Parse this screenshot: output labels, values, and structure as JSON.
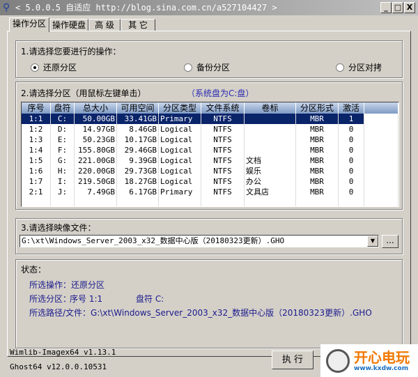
{
  "title": "< 5.0.0.5 自适应 http://blog.sina.com.cn/a527104427 >",
  "window_buttons": {
    "minimize": "_",
    "maximize": "□",
    "close": "X"
  },
  "tabs": [
    {
      "label": "操作分区"
    },
    {
      "label": "操作硬盘"
    },
    {
      "label": "高 级"
    },
    {
      "label": "其 它"
    }
  ],
  "step1": {
    "label": "1.请选择您要进行的操作：",
    "options": [
      {
        "label": "还原分区",
        "selected": true
      },
      {
        "label": "备份分区",
        "selected": false
      },
      {
        "label": "分区对拷",
        "selected": false
      }
    ]
  },
  "step2": {
    "label": "2.请选择分区（用鼠标左键单击）",
    "system_note": "（系统盘为C:盘）",
    "columns": [
      "序号",
      "盘符",
      "总大小",
      "可用空间",
      "分区类型",
      "文件系统",
      "卷标",
      "分区形式",
      "激活"
    ],
    "rows": [
      [
        "1:1",
        "C:",
        "50.00GB",
        "33.41GB",
        "Primary",
        "NTFS",
        "",
        "MBR",
        "1"
      ],
      [
        "1:2",
        "D:",
        "14.97GB",
        "8.46GB",
        "Logical",
        "NTFS",
        "",
        "MBR",
        "0"
      ],
      [
        "1:3",
        "E:",
        "50.23GB",
        "10.17GB",
        "Logical",
        "NTFS",
        "",
        "MBR",
        "0"
      ],
      [
        "1:4",
        "F:",
        "155.80GB",
        "29.46GB",
        "Logical",
        "NTFS",
        "",
        "MBR",
        "0"
      ],
      [
        "1:5",
        "G:",
        "221.00GB",
        "9.39GB",
        "Logical",
        "NTFS",
        "文档",
        "MBR",
        "0"
      ],
      [
        "1:6",
        "H:",
        "220.00GB",
        "29.73GB",
        "Logical",
        "NTFS",
        "娱乐",
        "MBR",
        "0"
      ],
      [
        "1:7",
        "I:",
        "219.50GB",
        "18.27GB",
        "Logical",
        "NTFS",
        "办公",
        "MBR",
        "0"
      ],
      [
        "2:1",
        "J:",
        "7.49GB",
        "6.17GB",
        "Primary",
        "NTFS",
        "文具店",
        "MBR",
        "0"
      ]
    ],
    "selected_row": 0
  },
  "step3": {
    "label": "3.请选择映像文件：",
    "value": "G:\\xt\\Windows_Server_2003_x32_数据中心版（20180323更新）.GHO",
    "browse": "..."
  },
  "status": {
    "label": "状态：",
    "op": "所选操作：还原分区",
    "part_label": "所选分区：",
    "part_num": "序号 1:1",
    "part_drive": "盘符 C:",
    "path": "所选路径/文件：G:\\xt\\Windows_Server_2003_x32_数据中心版（20180323更新）.GHO"
  },
  "footer": {
    "wimlib": "Wimlib-Imagex64 v1.13.1",
    "ghost": "Ghost64 v12.0.0.10531",
    "execute": "执 行"
  },
  "watermark": {
    "brand": "开心电玩",
    "url": "www.kxdw.com"
  }
}
